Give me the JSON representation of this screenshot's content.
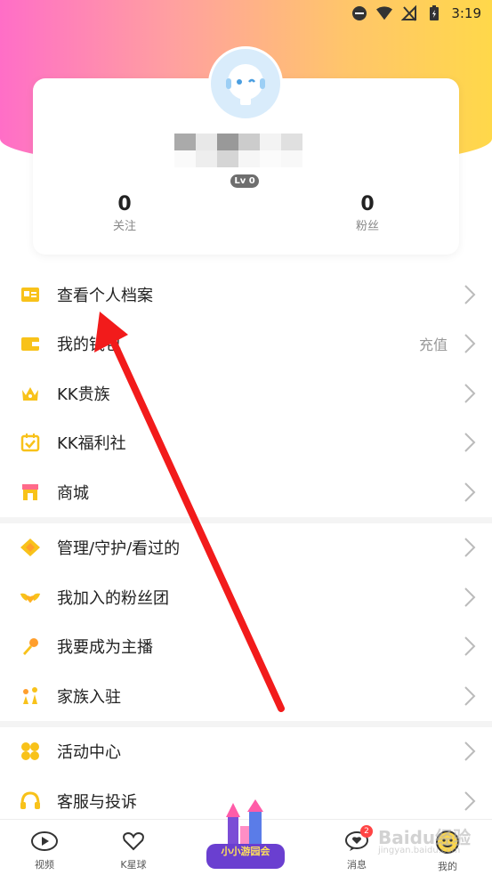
{
  "status_bar": {
    "time": "3:19"
  },
  "profile": {
    "level": "Lv 0",
    "following": {
      "count": "0",
      "label": "关注"
    },
    "fans": {
      "count": "0",
      "label": "粉丝"
    }
  },
  "menu_group_1": [
    {
      "label": "查看个人档案",
      "icon": "profile-card-icon"
    },
    {
      "label": "我的钱包",
      "icon": "wallet-icon",
      "extra": "充值"
    },
    {
      "label": "KK贵族",
      "icon": "crown-icon"
    },
    {
      "label": "KK福利社",
      "icon": "calendar-check-icon"
    },
    {
      "label": "商城",
      "icon": "shop-icon"
    }
  ],
  "menu_group_2": [
    {
      "label": "管理/守护/看过的",
      "icon": "diamond-icon"
    },
    {
      "label": "我加入的粉丝团",
      "icon": "wings-heart-icon"
    },
    {
      "label": "我要成为主播",
      "icon": "microphone-icon"
    },
    {
      "label": "家族入驻",
      "icon": "family-icon"
    }
  ],
  "menu_group_3": [
    {
      "label": "活动中心",
      "icon": "clover-icon"
    },
    {
      "label": "客服与投诉",
      "icon": "headset-icon"
    }
  ],
  "bottom_nav": {
    "video": "视频",
    "kstar": "K星球",
    "event": "小小游园会",
    "messages": "消息",
    "messages_badge": "2",
    "me": "我的"
  },
  "watermark": {
    "main": "Baidu经验",
    "sub": "jingyan.baidu.com"
  },
  "colors": {
    "accent": "#ffd84a",
    "pink": "#ff6ec7",
    "arrow": "#f21b1b",
    "icon_yellow": "#f8c21a"
  }
}
